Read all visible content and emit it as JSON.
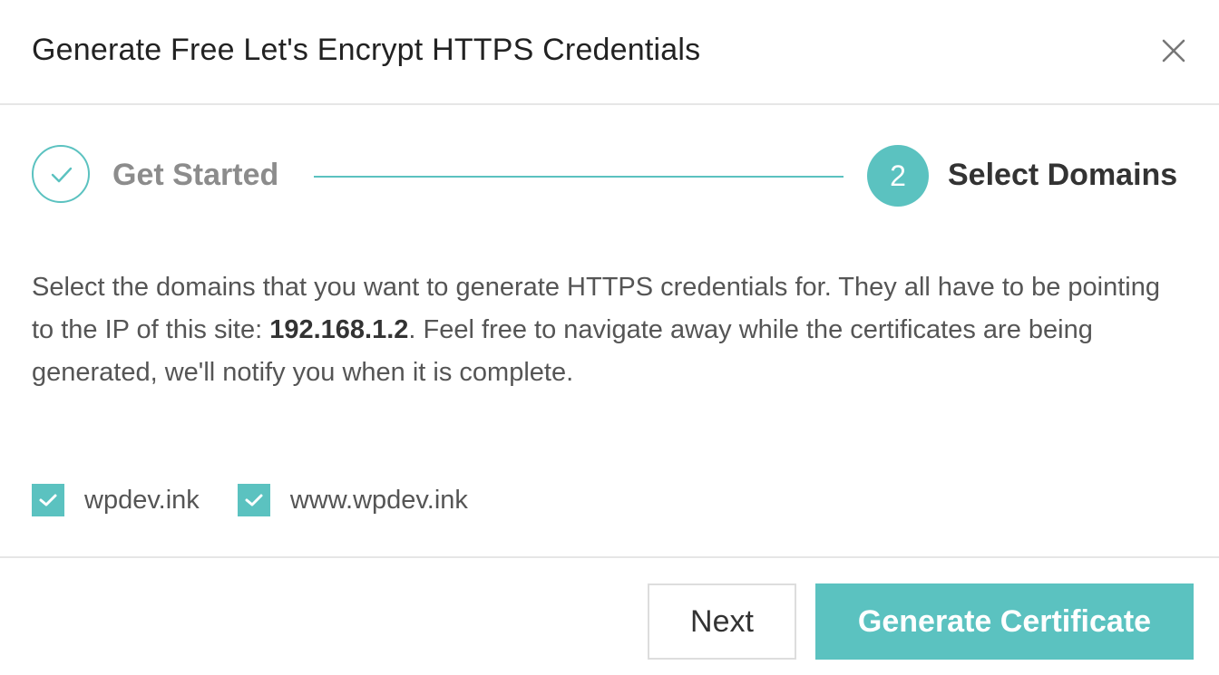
{
  "dialog": {
    "title": "Generate Free Let's Encrypt HTTPS Credentials",
    "close_icon": "close-icon"
  },
  "stepper": {
    "steps": [
      {
        "label": "Get Started",
        "state": "completed",
        "icon": "check-icon"
      },
      {
        "number": "2",
        "label": "Select Domains",
        "state": "active"
      }
    ]
  },
  "description": {
    "before_ip": "Select the domains that you want to generate HTTPS credentials for. They all have to be pointing to the IP of this site: ",
    "ip": "192.168.1.2",
    "after_ip": ". Feel free to navigate away while the certificates are being generated, we'll notify you when it is complete."
  },
  "domains": [
    {
      "label": "wpdev.ink",
      "checked": true
    },
    {
      "label": "www.wpdev.ink",
      "checked": true
    }
  ],
  "footer": {
    "next_label": "Next",
    "generate_label": "Generate Certificate"
  },
  "colors": {
    "accent": "#5bc2c0",
    "title": "#222222",
    "muted": "#8c8c8c",
    "body_text": "#555555",
    "divider": "#e6e6e6"
  }
}
